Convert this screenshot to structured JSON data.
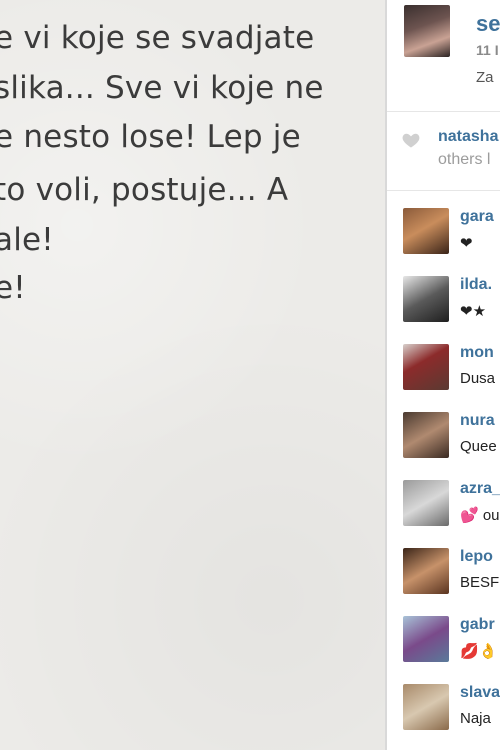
{
  "photo": {
    "lines": [
      "e vi koje se svadjate",
      "slika... Sve vi koje ne",
      "e nesto lose! Lep je",
      "to voli, postuje... A",
      "ale!",
      "e!"
    ]
  },
  "post": {
    "username": "se",
    "date": "11 I",
    "caption": "Za"
  },
  "likes": {
    "user": "natasha",
    "others": "others l"
  },
  "comments": [
    {
      "user": "gara",
      "text": "❤"
    },
    {
      "user": "ilda.",
      "text": "❤★"
    },
    {
      "user": "mon",
      "text": "Dusa"
    },
    {
      "user": "nura",
      "text": "Quee"
    },
    {
      "user": "azra_",
      "text": "💕 ou"
    },
    {
      "user": "lepo",
      "text": "BESF"
    },
    {
      "user": "gabr",
      "text": "💋👌"
    },
    {
      "user": "slava",
      "text": "Naja"
    }
  ],
  "colors": {
    "username": "#3f729b",
    "meta": "#8a8a8a"
  }
}
